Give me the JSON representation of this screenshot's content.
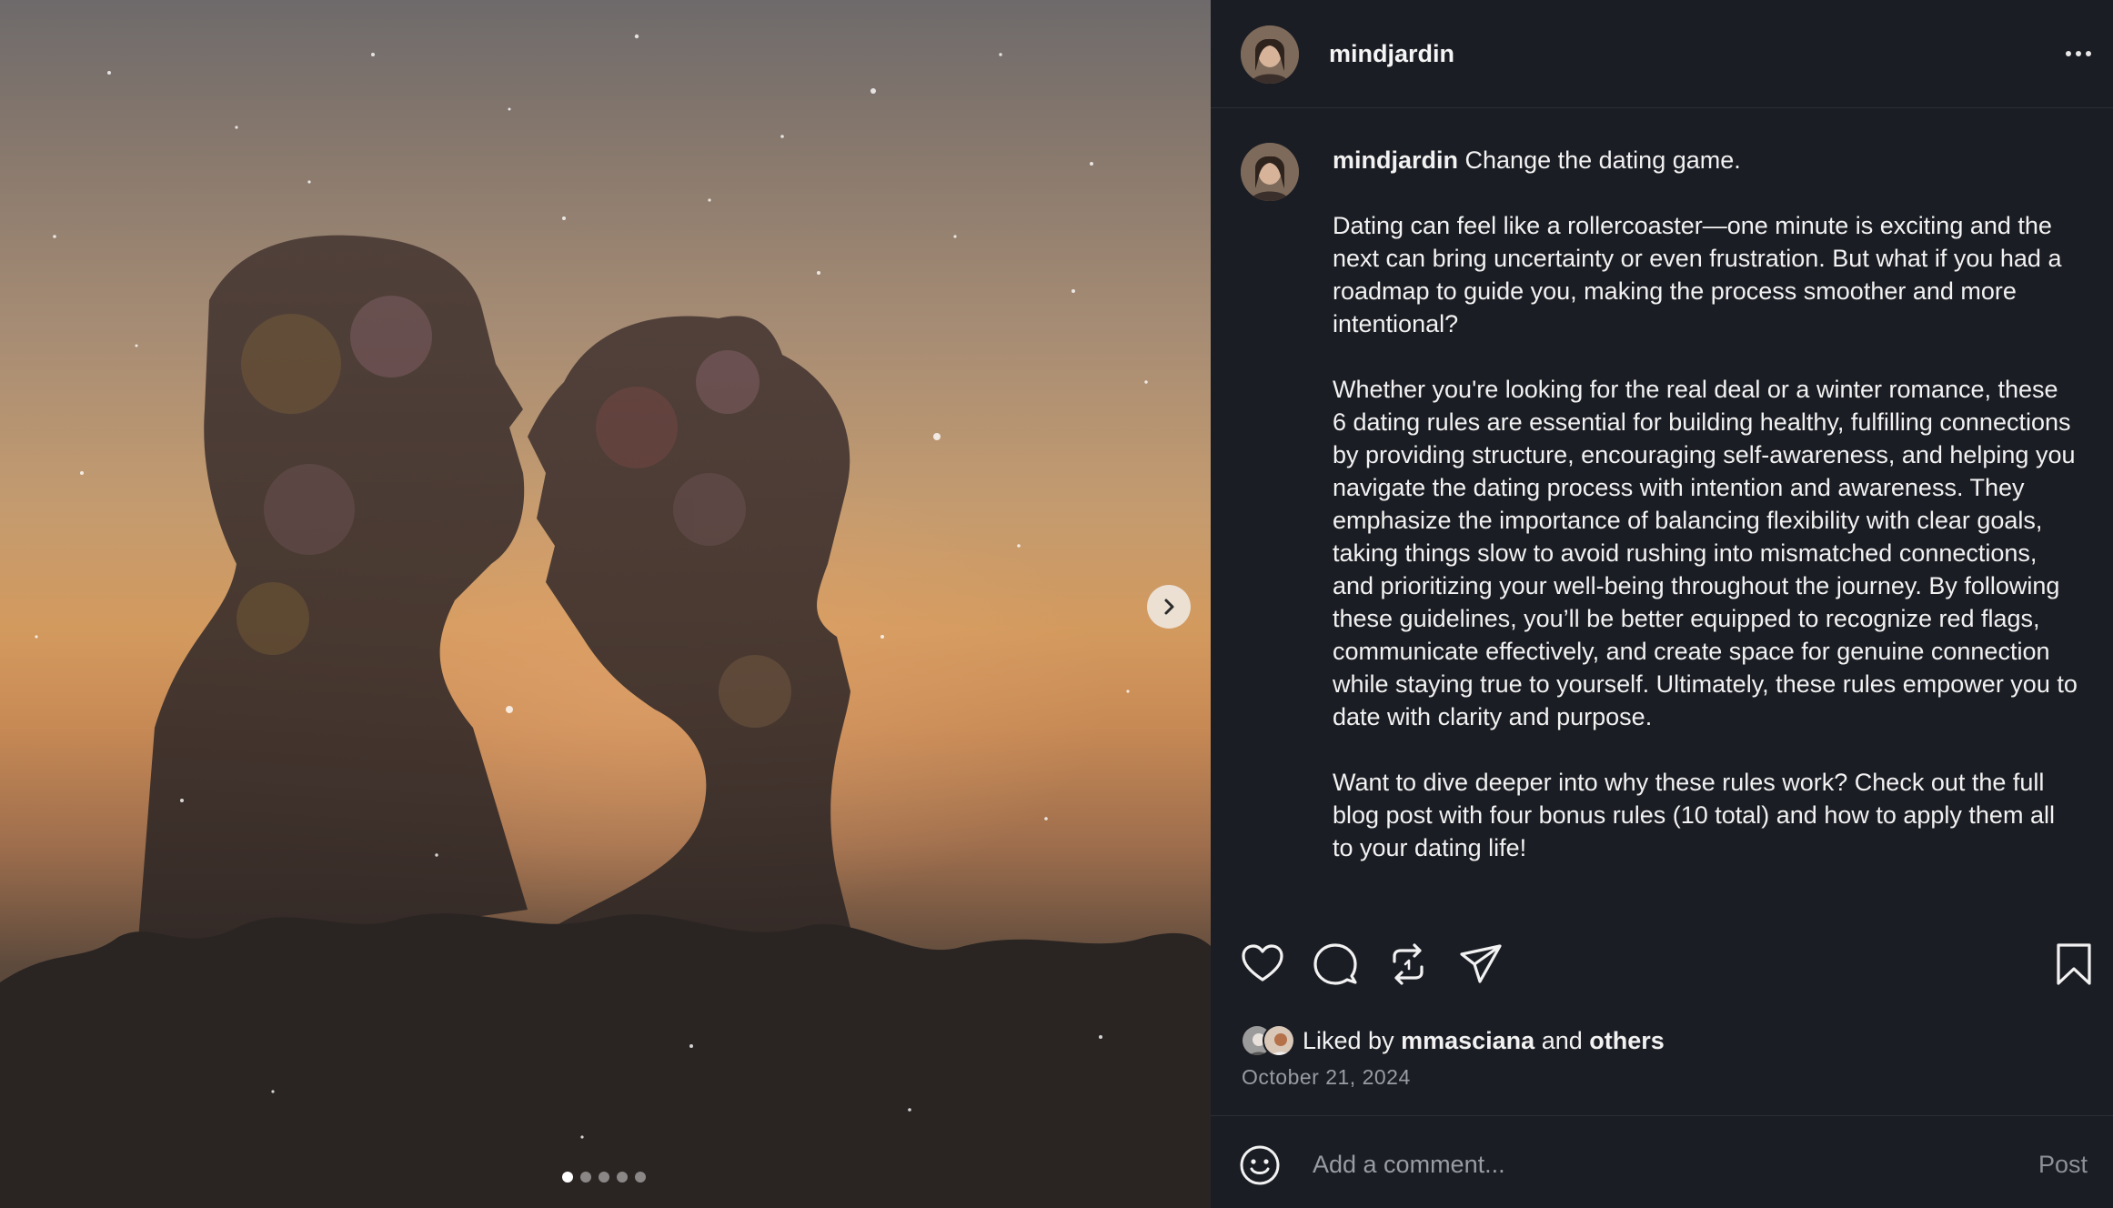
{
  "post": {
    "username": "mindjardin",
    "avatar_icon": "profile-photo-icon",
    "more_icon": "more-options-icon",
    "carousel": {
      "slide_count": 5,
      "active_index": 0,
      "next_icon": "chevron-right-icon"
    }
  },
  "caption": {
    "username": "mindjardin",
    "headline": "Change the dating game.",
    "paragraphs": [
      "Dating can feel like a rollercoaster—one minute is exciting and the next can bring uncertainty or even frustration. But what if you had a roadmap to guide you, making the process smoother and more intentional?",
      "Whether you're looking for the real deal or a winter romance, these 6 dating rules are essential for building healthy, fulfilling connections by providing structure, encouraging self-awareness, and helping you navigate the dating process with intention and awareness. They emphasize the importance of balancing flexibility with clear goals, taking things slow to avoid rushing into mismatched connections, and prioritizing your well-being throughout the journey. By following these guidelines, you’ll be better equipped to recognize red flags, communicate effectively, and create space for genuine connection while staying true to yourself. Ultimately, these rules empower you to date with clarity and purpose.",
      "Want to dive deeper into why these rules work? Check out the full blog post with four bonus rules (10 total) and how to apply them all to your dating life!"
    ]
  },
  "actions": {
    "icons": [
      "heart-icon",
      "comment-icon",
      "repost-icon",
      "share-icon",
      "bookmark-icon"
    ]
  },
  "likes": {
    "prefix": "Liked by",
    "user": "mmasciana",
    "joiner": "and",
    "others": "others"
  },
  "date": "October 21, 2024",
  "comment": {
    "placeholder": "Add a comment...",
    "post_label": "Post",
    "emoji_icon": "smiley-icon"
  },
  "colors": {
    "panel_bg": "#1b1d24",
    "text": "#f5f5f5",
    "muted": "#9a9ca3"
  }
}
